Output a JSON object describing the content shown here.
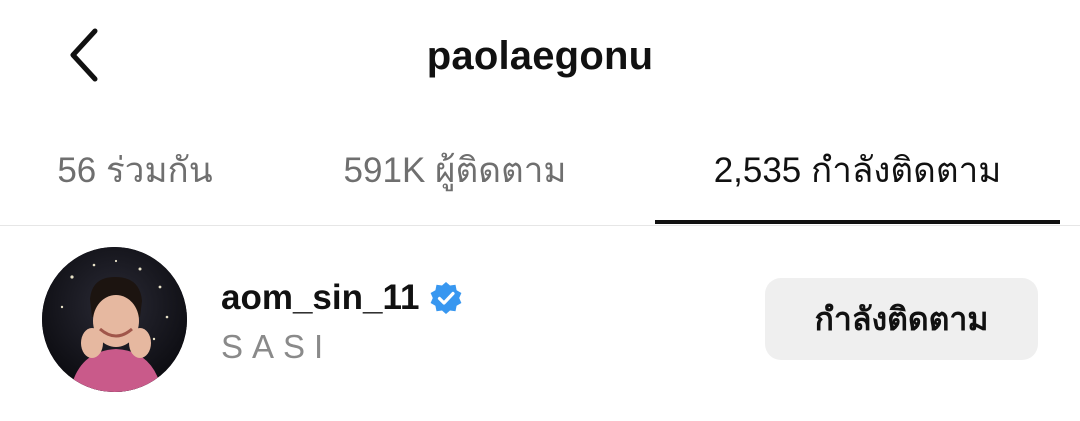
{
  "header": {
    "back_icon": "chevron-left-icon",
    "title": "paolaegonu"
  },
  "tabs": [
    {
      "label": "56 ร่วมกัน",
      "active": false
    },
    {
      "label": "591K ผู้ติดตาม",
      "active": false
    },
    {
      "label": "2,535 กำลังติดตาม",
      "active": true
    }
  ],
  "accounts": [
    {
      "username": "aom_sin_11",
      "verified": true,
      "verified_icon": "verified-badge-icon",
      "full_name": "SASI",
      "button_label": "กำลังติดตาม"
    }
  ],
  "colors": {
    "text_primary": "#111111",
    "text_muted": "#6f6f6f",
    "verified_blue": "#3897f0",
    "button_bg": "#efefef",
    "divider": "#e6e6e6"
  }
}
